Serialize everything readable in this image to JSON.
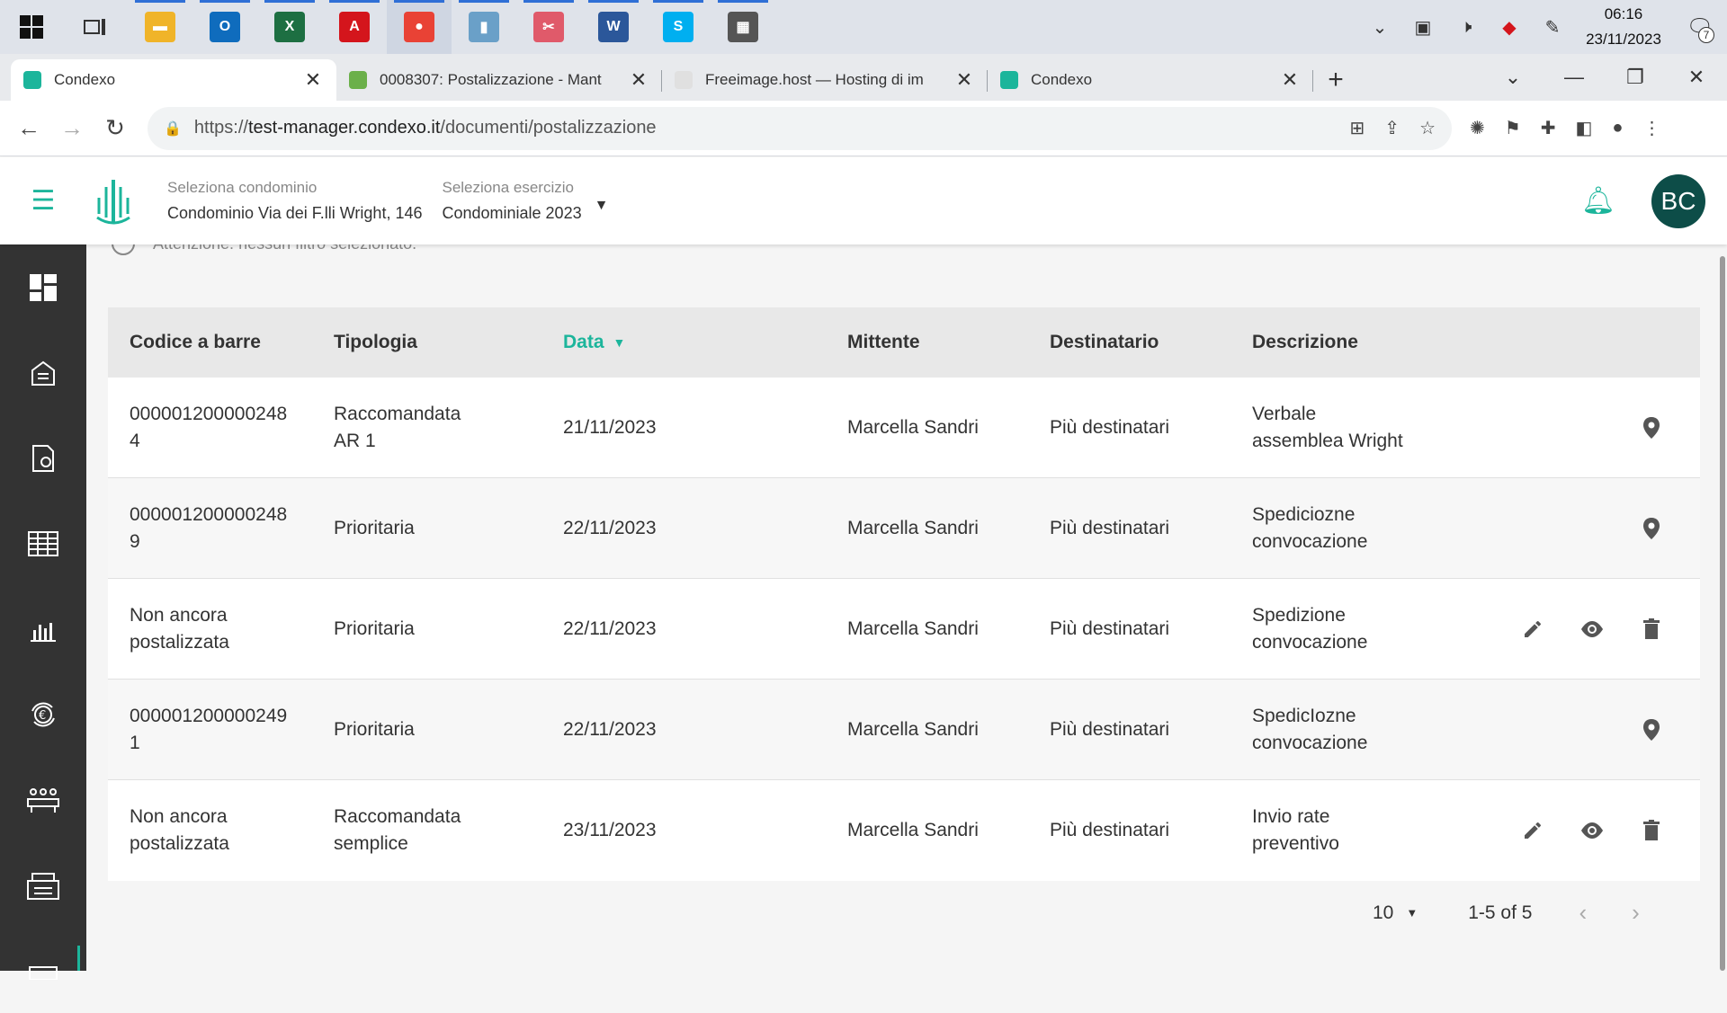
{
  "taskbar": {
    "apps": [
      {
        "name": "file-explorer-icon",
        "color": "#f0b429",
        "glyph": "▬"
      },
      {
        "name": "outlook-icon",
        "color": "#0f6cbd",
        "glyph": "O"
      },
      {
        "name": "excel-icon",
        "color": "#1d6f42",
        "glyph": "X"
      },
      {
        "name": "acrobat-icon",
        "color": "#d4151c",
        "glyph": "A"
      },
      {
        "name": "chrome-icon",
        "color": "#e94235",
        "glyph": "●"
      },
      {
        "name": "notes-icon",
        "color": "#6aa0c8",
        "glyph": "▮"
      },
      {
        "name": "snipping-icon",
        "color": "#e05a6a",
        "glyph": "✂"
      },
      {
        "name": "word-icon",
        "color": "#2b579a",
        "glyph": "W"
      },
      {
        "name": "skype-icon",
        "color": "#00aff0",
        "glyph": "S"
      },
      {
        "name": "calculator-icon",
        "color": "#555555",
        "glyph": "▦"
      }
    ],
    "clock_time": "06:16",
    "clock_date": "23/11/2023",
    "notification_count": "7"
  },
  "browser": {
    "tabs": [
      {
        "title": "Condexo",
        "active": true
      },
      {
        "title": "0008307: Postalizzazione - Mant",
        "active": false
      },
      {
        "title": "Freeimage.host — Hosting di im",
        "active": false
      },
      {
        "title": "Condexo",
        "active": false
      }
    ],
    "url_prefix": "https://",
    "url_host": "test-manager.condexo.it",
    "url_path": "/documenti/postalizzazione"
  },
  "header": {
    "condominio_label": "Seleziona condominio",
    "condominio_value": "Condominio Via dei F.lli Wright, 146",
    "esercizio_label": "Seleziona esercizio",
    "esercizio_value": "Condominiale 2023",
    "avatar_initials": "BC"
  },
  "main": {
    "filter_note": "Attenzione: nessun filtro selezionato."
  },
  "table": {
    "columns": [
      "Codice a barre",
      "Tipologia",
      "Data",
      "Mittente",
      "Destinatario",
      "Descrizione"
    ],
    "rows": [
      {
        "code1": "000001200000248",
        "code2": "4",
        "type1": "Raccomandata",
        "type2": "AR 1",
        "date": "21/11/2023",
        "sender": "Marcella Sandri",
        "recipient": "Più destinatari",
        "desc1": "Verbale",
        "desc2": "assemblea Wright",
        "actions": [
          "location"
        ]
      },
      {
        "code1": "000001200000248",
        "code2": "9",
        "type1": "Prioritaria",
        "type2": "",
        "date": "22/11/2023",
        "sender": "Marcella Sandri",
        "recipient": "Più destinatari",
        "desc1": "Spediciozne",
        "desc2": "convocazione",
        "actions": [
          "location"
        ]
      },
      {
        "code1": "Non ancora",
        "code2": "postalizzata",
        "type1": "Prioritaria",
        "type2": "",
        "date": "22/11/2023",
        "sender": "Marcella Sandri",
        "recipient": "Più destinatari",
        "desc1": "Spedizione",
        "desc2": "convocazione",
        "actions": [
          "edit",
          "view",
          "delete"
        ]
      },
      {
        "code1": "000001200000249",
        "code2": "1",
        "type1": "Prioritaria",
        "type2": "",
        "date": "22/11/2023",
        "sender": "Marcella Sandri",
        "recipient": "Più destinatari",
        "desc1": "SpedicIozne",
        "desc2": "convocazione",
        "actions": [
          "location"
        ]
      },
      {
        "code1": "Non ancora",
        "code2": "postalizzata",
        "type1": "Raccomandata",
        "type2": "semplice",
        "date": "23/11/2023",
        "sender": "Marcella Sandri",
        "recipient": "Più destinatari",
        "desc1": "Invio rate",
        "desc2": "preventivo",
        "actions": [
          "edit",
          "view",
          "delete"
        ]
      }
    ]
  },
  "pagination": {
    "per_page": "10",
    "range": "1-5 of 5"
  },
  "colors": {
    "accent": "#1cb59b",
    "sidebar": "#333333",
    "avatar": "#0d4d48"
  }
}
